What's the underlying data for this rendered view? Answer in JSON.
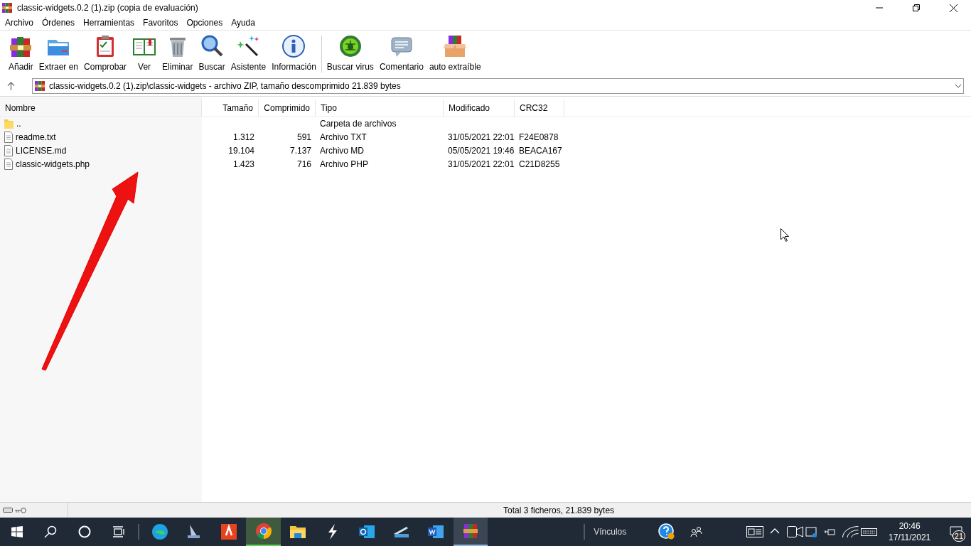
{
  "window": {
    "title": "classic-widgets.0.2 (1).zip (copia de evaluación)"
  },
  "menu": [
    "Archivo",
    "Órdenes",
    "Herramientas",
    "Favoritos",
    "Opciones",
    "Ayuda"
  ],
  "toolbar": {
    "groups": [
      [
        {
          "kind": "add",
          "label": "Añadir"
        },
        {
          "kind": "extract",
          "label": "Extraer en"
        },
        {
          "kind": "test",
          "label": "Comprobar"
        },
        {
          "kind": "view",
          "label": "Ver"
        },
        {
          "kind": "delete",
          "label": "Eliminar"
        },
        {
          "kind": "find",
          "label": "Buscar"
        },
        {
          "kind": "wizard",
          "label": "Asistente"
        },
        {
          "kind": "info",
          "label": "Información"
        }
      ],
      [
        {
          "kind": "virus",
          "label": "Buscar virus"
        },
        {
          "kind": "comment",
          "label": "Comentario"
        },
        {
          "kind": "sfx",
          "label": "auto extraíble"
        }
      ]
    ]
  },
  "address": {
    "path": "classic-widgets.0.2 (1).zip\\classic-widgets - archivo ZIP, tamaño descomprimido 21.839 bytes"
  },
  "table": {
    "columns": [
      "Nombre",
      "Tamaño",
      "Comprimido",
      "Tipo",
      "Modificado",
      "CRC32"
    ],
    "rows": [
      {
        "kind": "folder",
        "cells": [
          "..",
          "",
          "",
          "Carpeta de archivos",
          "",
          ""
        ]
      },
      {
        "kind": "file",
        "cells": [
          "readme.txt",
          "1.312",
          "591",
          "Archivo TXT",
          "31/05/2021 22:01",
          "F24E0878"
        ]
      },
      {
        "kind": "file",
        "cells": [
          "LICENSE.md",
          "19.104",
          "7.137",
          "Archivo MD",
          "05/05/2021 19:46",
          "BEACA167"
        ]
      },
      {
        "kind": "file",
        "cells": [
          "classic-widgets.php",
          "1.423",
          "716",
          "Archivo PHP",
          "31/05/2021 22:01",
          "C21D8255"
        ]
      }
    ]
  },
  "status_bar": {
    "total": "Total 3 ficheros, 21.839 bytes"
  },
  "taskbar": {
    "apps": [
      {
        "kind": "edge",
        "selected": false,
        "attention": false
      },
      {
        "kind": "scanner",
        "selected": false,
        "attention": false
      },
      {
        "kind": "pdf",
        "selected": false,
        "attention": false
      },
      {
        "kind": "chrome",
        "selected": false,
        "attention": true
      },
      {
        "kind": "explorer",
        "selected": false,
        "attention": false
      },
      {
        "kind": "bolt",
        "selected": false,
        "attention": false
      },
      {
        "kind": "outlook",
        "selected": false,
        "attention": false
      },
      {
        "kind": "scanner2",
        "selected": false,
        "attention": false
      },
      {
        "kind": "word",
        "selected": false,
        "attention": false
      },
      {
        "kind": "winrar",
        "selected": true,
        "attention": false
      }
    ],
    "links_label": "Vínculos",
    "time": "20:46",
    "date": "17/11/2021",
    "notifications": "21"
  }
}
